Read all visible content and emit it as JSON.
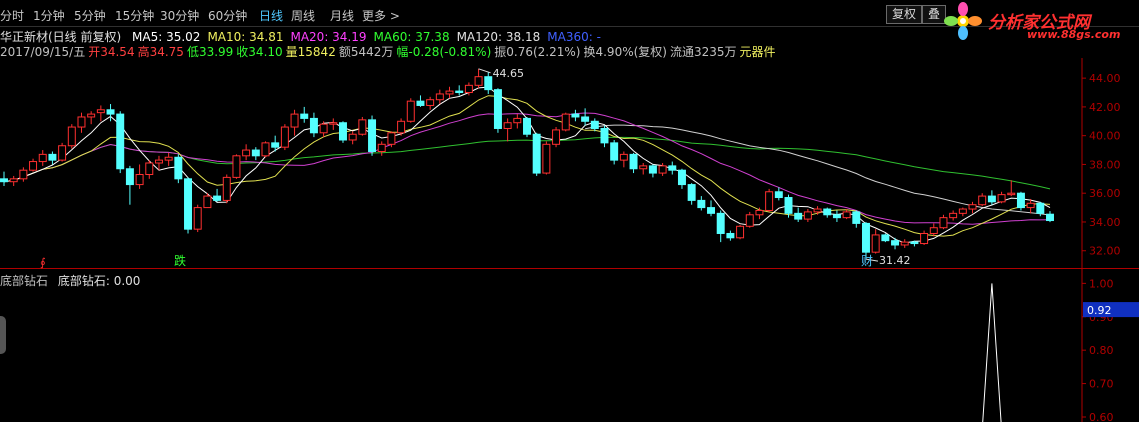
{
  "toolbar": {
    "timeframes": [
      "分时",
      "1分钟",
      "5分钟",
      "15分钟",
      "30分钟",
      "60分钟",
      "日线",
      "周线",
      "月线",
      "更多 >"
    ],
    "active_index": 6,
    "buttons": [
      "复权",
      "叠"
    ]
  },
  "logo": {
    "text": "分析家公式网",
    "url": "www.88gs.com"
  },
  "ma_row": {
    "title": "华正新材(日线 前复权)",
    "items": [
      {
        "label": "MA5: 35.02",
        "color": "#ffffff"
      },
      {
        "label": "MA10: 34.81",
        "color": "#f0f060"
      },
      {
        "label": "MA20: 34.19",
        "color": "#ff40ff"
      },
      {
        "label": "MA60: 37.38",
        "color": "#30ff30"
      },
      {
        "label": "MA120: 38.18",
        "color": "#e0e0e0"
      },
      {
        "label": "MA360: -",
        "color": "#4060ff"
      }
    ]
  },
  "quote_row": {
    "items": [
      {
        "label": "2017/09/15/五",
        "color": "#c0c0c0"
      },
      {
        "label": "开34.54",
        "color": "#ff4040"
      },
      {
        "label": "高34.75",
        "color": "#ff4040"
      },
      {
        "label": "低33.99",
        "color": "#30ff30"
      },
      {
        "label": "收34.10",
        "color": "#30ff30"
      },
      {
        "label": "量15842",
        "color": "#f0f060"
      },
      {
        "label": "额5442万",
        "color": "#c0c0c0"
      },
      {
        "label": "幅-0.28(-0.81%)",
        "color": "#30ff30"
      },
      {
        "label": "振0.76(2.21%)",
        "color": "#c0c0c0"
      },
      {
        "label": "换4.90%(复权)",
        "color": "#c0c0c0"
      },
      {
        "label": "流通3235万",
        "color": "#c0c0c0"
      },
      {
        "label": "元器件",
        "color": "#f0f060"
      }
    ]
  },
  "price_axis": {
    "labels": [
      "44.00",
      "42.00",
      "40.00",
      "38.00",
      "36.00",
      "34.00",
      "32.00"
    ],
    "min": 30.8,
    "max": 45.4
  },
  "annotations": {
    "high": "44.65",
    "low": "31.42",
    "marker_down": "跌",
    "marker_fin": "财",
    "marker_left": "∮"
  },
  "indicator": {
    "name": "底部钻石",
    "value_label": "底部钻石: 0.00",
    "axis_labels": [
      "1.00",
      "0.90",
      "0.80",
      "0.70",
      "0.60"
    ],
    "current": "0.92",
    "min": 0.585,
    "max": 1.04
  },
  "colors": {
    "up": "#ff3030",
    "down": "#54ffff",
    "axis": "#b00000"
  },
  "chart_data": {
    "type": "candlestick",
    "ohlc": [
      [
        37.0,
        37.5,
        36.5,
        36.8
      ],
      [
        36.8,
        37.2,
        36.5,
        37.0
      ],
      [
        37.0,
        37.8,
        36.8,
        37.6
      ],
      [
        37.6,
        38.4,
        37.5,
        38.2
      ],
      [
        38.2,
        39.0,
        37.9,
        38.7
      ],
      [
        38.7,
        38.9,
        38.0,
        38.3
      ],
      [
        38.3,
        39.5,
        38.2,
        39.3
      ],
      [
        39.3,
        40.8,
        39.1,
        40.6
      ],
      [
        40.6,
        41.6,
        40.2,
        41.3
      ],
      [
        41.3,
        41.7,
        40.8,
        41.5
      ],
      [
        41.6,
        42.1,
        41.0,
        41.8
      ],
      [
        41.8,
        42.2,
        41.0,
        41.5
      ],
      [
        41.5,
        41.7,
        37.4,
        37.7
      ],
      [
        37.7,
        37.9,
        35.2,
        36.6
      ],
      [
        36.6,
        38.0,
        36.3,
        37.3
      ],
      [
        37.3,
        38.3,
        37.0,
        38.1
      ],
      [
        38.1,
        38.6,
        37.6,
        38.3
      ],
      [
        38.3,
        38.8,
        37.9,
        38.5
      ],
      [
        38.5,
        38.7,
        36.7,
        37.0
      ],
      [
        37.0,
        37.1,
        33.2,
        33.5
      ],
      [
        33.5,
        35.2,
        33.3,
        35.0
      ],
      [
        35.0,
        36.0,
        35.0,
        35.8
      ],
      [
        35.8,
        36.3,
        35.4,
        35.5
      ],
      [
        35.5,
        37.3,
        35.3,
        37.1
      ],
      [
        37.1,
        38.7,
        37.0,
        38.6
      ],
      [
        38.6,
        39.4,
        38.3,
        39.0
      ],
      [
        39.0,
        39.2,
        38.3,
        38.6
      ],
      [
        38.6,
        39.6,
        38.5,
        39.5
      ],
      [
        39.5,
        40.0,
        38.9,
        39.2
      ],
      [
        39.2,
        40.8,
        39.0,
        40.6
      ],
      [
        40.6,
        41.8,
        40.0,
        41.5
      ],
      [
        41.5,
        42.0,
        40.9,
        41.2
      ],
      [
        41.2,
        41.6,
        39.9,
        40.2
      ],
      [
        40.2,
        41.0,
        39.9,
        40.8
      ],
      [
        40.8,
        41.2,
        40.4,
        40.9
      ],
      [
        40.9,
        41.0,
        39.5,
        39.7
      ],
      [
        39.7,
        40.3,
        39.4,
        40.1
      ],
      [
        40.1,
        41.3,
        40.0,
        41.1
      ],
      [
        41.1,
        41.4,
        38.6,
        38.9
      ],
      [
        38.9,
        39.6,
        38.6,
        39.4
      ],
      [
        39.4,
        40.3,
        39.2,
        40.2
      ],
      [
        40.2,
        41.2,
        40.0,
        41.0
      ],
      [
        41.0,
        42.6,
        40.9,
        42.4
      ],
      [
        42.4,
        42.8,
        42.0,
        42.1
      ],
      [
        42.1,
        42.7,
        41.8,
        42.5
      ],
      [
        42.5,
        43.2,
        42.2,
        42.9
      ],
      [
        42.9,
        43.4,
        42.6,
        43.1
      ],
      [
        43.1,
        43.5,
        42.8,
        43.0
      ],
      [
        43.0,
        43.7,
        42.8,
        43.5
      ],
      [
        43.5,
        44.65,
        43.3,
        44.1
      ],
      [
        44.1,
        44.4,
        42.9,
        43.2
      ],
      [
        43.2,
        43.3,
        40.2,
        40.5
      ],
      [
        40.5,
        41.2,
        39.6,
        40.9
      ],
      [
        40.9,
        41.5,
        40.5,
        41.2
      ],
      [
        41.2,
        41.3,
        39.9,
        40.1
      ],
      [
        40.1,
        40.2,
        37.2,
        37.4
      ],
      [
        37.4,
        39.6,
        37.3,
        39.4
      ],
      [
        39.4,
        40.6,
        39.2,
        40.4
      ],
      [
        40.4,
        41.6,
        40.3,
        41.5
      ],
      [
        41.5,
        41.8,
        41.0,
        41.3
      ],
      [
        41.3,
        41.9,
        40.7,
        41.0
      ],
      [
        41.0,
        41.2,
        40.3,
        40.5
      ],
      [
        40.5,
        40.7,
        39.2,
        39.5
      ],
      [
        39.5,
        39.7,
        38.0,
        38.3
      ],
      [
        38.3,
        38.9,
        37.8,
        38.7
      ],
      [
        38.7,
        38.8,
        37.4,
        37.7
      ],
      [
        37.7,
        38.1,
        37.3,
        37.9
      ],
      [
        37.9,
        38.0,
        37.1,
        37.4
      ],
      [
        37.4,
        38.1,
        37.2,
        37.9
      ],
      [
        37.9,
        38.2,
        37.3,
        37.6
      ],
      [
        37.6,
        37.7,
        36.3,
        36.6
      ],
      [
        36.6,
        36.7,
        35.2,
        35.5
      ],
      [
        35.5,
        35.8,
        34.8,
        35.0
      ],
      [
        35.0,
        35.5,
        34.4,
        34.6
      ],
      [
        34.6,
        34.8,
        32.6,
        33.2
      ],
      [
        33.2,
        33.4,
        32.7,
        32.9
      ],
      [
        32.9,
        33.8,
        32.8,
        33.7
      ],
      [
        33.7,
        34.7,
        33.6,
        34.5
      ],
      [
        34.5,
        35.0,
        34.2,
        34.8
      ],
      [
        34.8,
        36.3,
        34.7,
        36.1
      ],
      [
        36.1,
        36.4,
        35.5,
        35.7
      ],
      [
        35.7,
        35.9,
        34.3,
        34.6
      ],
      [
        34.6,
        35.0,
        34.0,
        34.2
      ],
      [
        34.2,
        34.9,
        34.0,
        34.7
      ],
      [
        34.7,
        35.1,
        34.5,
        34.9
      ],
      [
        34.9,
        35.0,
        34.3,
        34.5
      ],
      [
        34.5,
        34.8,
        34.0,
        34.3
      ],
      [
        34.3,
        34.9,
        34.2,
        34.7
      ],
      [
        34.7,
        34.8,
        33.6,
        33.9
      ],
      [
        33.9,
        34.0,
        31.42,
        31.9
      ],
      [
        31.9,
        33.5,
        31.8,
        33.1
      ],
      [
        33.1,
        33.2,
        32.6,
        32.7
      ],
      [
        32.7,
        32.9,
        32.1,
        32.4
      ],
      [
        32.4,
        32.8,
        32.2,
        32.6
      ],
      [
        32.6,
        32.7,
        32.3,
        32.5
      ],
      [
        32.5,
        33.4,
        32.4,
        33.2
      ],
      [
        33.2,
        33.9,
        33.0,
        33.6
      ],
      [
        33.6,
        34.5,
        33.5,
        34.3
      ],
      [
        34.3,
        34.8,
        34.1,
        34.6
      ],
      [
        34.6,
        35.0,
        34.4,
        34.9
      ],
      [
        34.9,
        35.4,
        34.6,
        35.2
      ],
      [
        35.2,
        36.0,
        35.1,
        35.8
      ],
      [
        35.8,
        36.2,
        35.2,
        35.4
      ],
      [
        35.4,
        36.1,
        35.3,
        35.9
      ],
      [
        35.9,
        36.9,
        35.8,
        36.0
      ],
      [
        36.0,
        36.1,
        34.8,
        35.0
      ],
      [
        35.0,
        35.6,
        34.6,
        35.3
      ],
      [
        35.3,
        35.4,
        34.4,
        34.6
      ],
      [
        34.54,
        34.75,
        33.99,
        34.1
      ]
    ],
    "indicator_values": [
      0,
      0,
      0,
      0,
      0,
      0,
      0,
      0,
      0,
      0,
      0,
      0,
      0,
      0,
      0,
      0,
      0,
      0,
      0,
      0,
      0,
      0,
      0,
      0,
      0,
      0,
      0,
      0,
      0,
      0,
      0,
      0,
      0,
      0,
      0,
      0,
      0,
      0,
      0,
      0,
      0,
      0,
      0,
      0,
      0,
      0,
      0,
      0,
      0,
      0,
      0,
      0,
      0,
      0,
      0,
      0,
      0,
      0,
      0,
      0,
      0,
      0,
      0,
      0,
      0,
      0,
      0,
      0,
      0,
      0,
      0,
      0,
      0,
      0,
      0,
      0,
      0,
      0,
      0,
      0,
      0,
      0,
      0,
      0,
      0,
      0,
      0,
      0,
      0,
      0,
      0,
      0,
      0,
      0,
      0,
      0,
      0,
      0,
      0,
      0,
      0,
      0,
      1.0,
      0,
      0,
      0,
      0,
      0,
      0,
      0,
      0
    ]
  }
}
